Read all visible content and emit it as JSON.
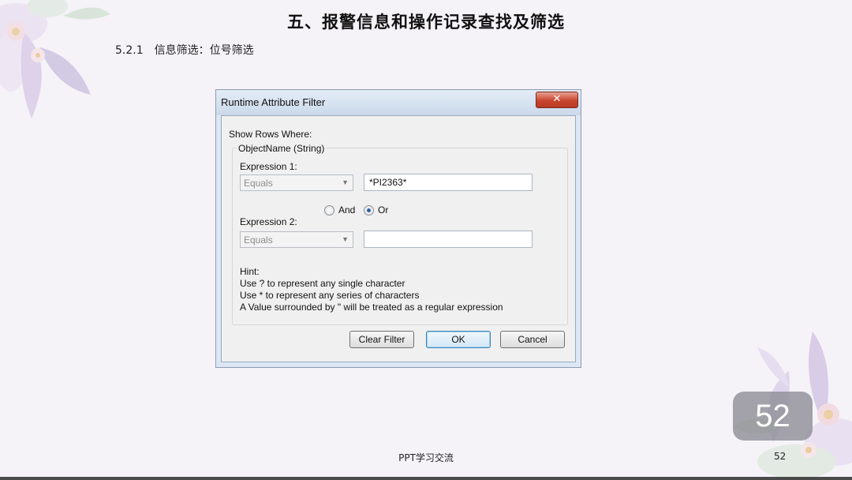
{
  "slide": {
    "title": "五、报警信息和操作记录查找及筛选",
    "section_number": "5.2.1",
    "section_label": "信息筛选：位号筛选",
    "page_badge": "52",
    "footer_text": "PPT学习交流",
    "footer_page": "52"
  },
  "dialog": {
    "title": "Runtime Attribute Filter",
    "close_label": "✕",
    "show_rows_label": "Show Rows Where:",
    "group_label": "ObjectName (String)",
    "expression1": {
      "label": "Expression 1:",
      "operator": "Equals",
      "value": "*PI2363*"
    },
    "logic": {
      "and_label": "And",
      "or_label": "Or",
      "selected": "Or"
    },
    "expression2": {
      "label": "Expression 2:",
      "operator": "Equals",
      "value": ""
    },
    "hint": {
      "title": "Hint:",
      "line1": "Use ? to represent any single character",
      "line2": "Use * to represent any series of characters",
      "line3": "A Value surrounded by \" will be treated as a regular expression"
    },
    "buttons": {
      "clear": "Clear Filter",
      "ok": "OK",
      "cancel": "Cancel"
    }
  },
  "colors": {
    "slide_background": "#f5f2f8",
    "close_button": "#c8452f",
    "radio_selected": "#2a5ea8"
  }
}
